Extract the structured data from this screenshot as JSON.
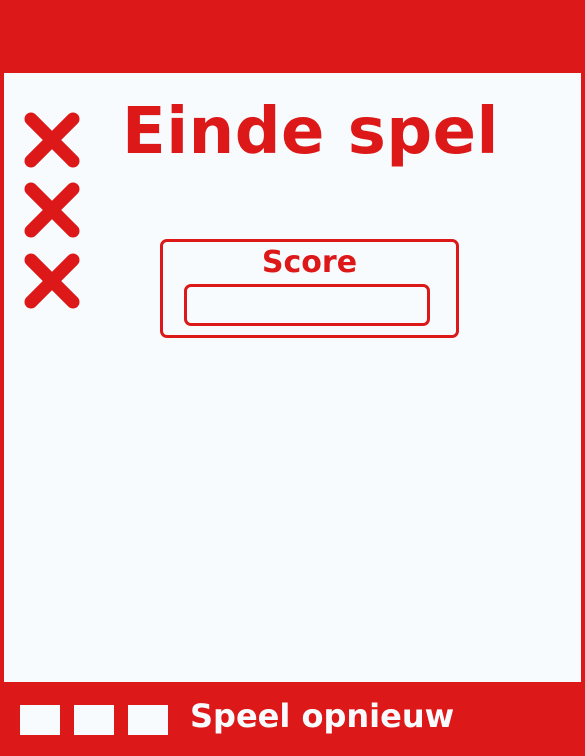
{
  "game": {
    "title": "Einde spel",
    "score_label": "Score",
    "score_value": "",
    "restart_label": "Speel opnieuw",
    "misses": [
      "cross-icon",
      "cross-icon",
      "cross-icon"
    ],
    "life_indicators": [
      "square-icon",
      "square-icon",
      "square-icon"
    ]
  },
  "colors": {
    "accent": "#dd1818",
    "background": "#f8fbfe"
  }
}
